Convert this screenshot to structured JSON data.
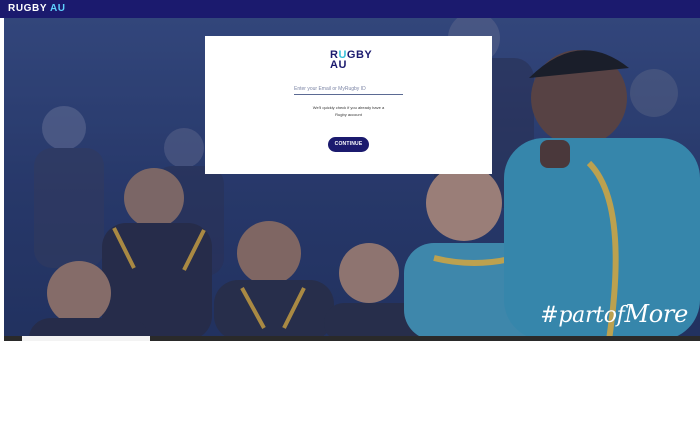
{
  "header": {
    "brand_rugby": "RUGBY",
    "brand_au": "AU"
  },
  "hero": {
    "tagline_part": "#partof",
    "tagline_more": "More"
  },
  "login": {
    "logo_r": "R",
    "logo_u": "U",
    "logo_gby": "GBY",
    "logo_au": "AU",
    "email_placeholder": "Enter your Email or MyRugby ID",
    "hint_line1": "We'll quickly check if you already have a",
    "hint_line2": "Rugby account",
    "continue_label": "CONTINUE"
  },
  "colors": {
    "navy": "#1b1a6e",
    "teal": "#39c0d9",
    "accent": "#5fd2ff"
  }
}
